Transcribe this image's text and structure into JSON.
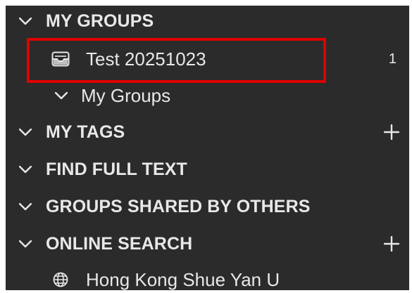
{
  "sidebar": {
    "my_groups": {
      "label": "MY GROUPS",
      "icon": "chevron-down-icon",
      "items": [
        {
          "label": "Test 20251023",
          "icon": "group-tray-icon",
          "count": "1"
        }
      ],
      "sub_section": {
        "label": "My Groups",
        "icon": "chevron-down-icon"
      }
    },
    "my_tags": {
      "label": "MY TAGS",
      "icon": "chevron-down-icon",
      "add_icon": "plus-icon"
    },
    "find_full_text": {
      "label": "FIND FULL TEXT",
      "icon": "chevron-down-icon"
    },
    "groups_shared": {
      "label": "GROUPS SHARED BY OTHERS",
      "icon": "chevron-down-icon"
    },
    "online_search": {
      "label": "ONLINE SEARCH",
      "icon": "chevron-down-icon",
      "add_icon": "plus-icon",
      "items": [
        {
          "label": "Hong Kong Shue Yan U",
          "icon": "globe-icon"
        }
      ]
    }
  },
  "colors": {
    "panel_background": "#2b2b2b",
    "text": "#e8e8e8",
    "highlight_border": "#e00000"
  }
}
